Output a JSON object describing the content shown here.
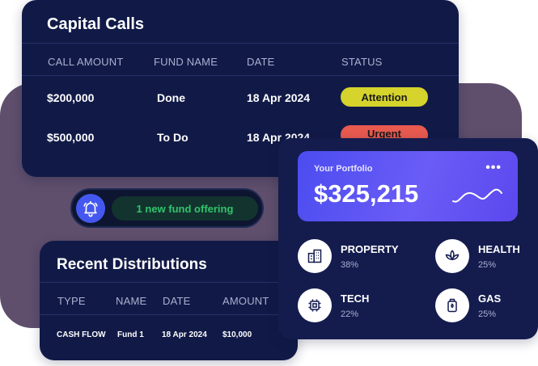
{
  "capital_calls": {
    "title": "Capital Calls",
    "headers": [
      "CALL AMOUNT",
      "FUND NAME",
      "DATE",
      "STATUS"
    ],
    "rows": [
      {
        "amount": "$200,000",
        "fund": "Done",
        "date": "18 Apr 2024",
        "status": "Attention",
        "status_color": "#d5d32c"
      },
      {
        "amount": "$500,000",
        "fund": "To Do",
        "date": "18 Apr 2024",
        "status": "Urgent",
        "status_color": "#e85a4f"
      }
    ]
  },
  "notification": {
    "icon": "bell-icon",
    "text": "1 new fund offering"
  },
  "distributions": {
    "title": "Recent Distributions",
    "headers": [
      "TYPE",
      "NAME",
      "DATE",
      "AMOUNT"
    ],
    "rows": [
      {
        "type": "CASH FLOW",
        "name": "Fund 1",
        "date": "18 Apr 2024",
        "amount": "$10,000"
      }
    ]
  },
  "portfolio": {
    "label": "Your Portfolio",
    "value": "$325,215",
    "categories": [
      {
        "name": "PROPERTY",
        "pct": "38%",
        "icon": "building-icon"
      },
      {
        "name": "HEALTH",
        "pct": "25%",
        "icon": "lotus-icon"
      },
      {
        "name": "TECH",
        "pct": "22%",
        "icon": "chip-icon"
      },
      {
        "name": "GAS",
        "pct": "25%",
        "icon": "gas-canister-icon"
      }
    ]
  },
  "colors": {
    "card": "#111a47",
    "accent": "#4b4cf0",
    "bg_shape": "#5f4f6d"
  }
}
